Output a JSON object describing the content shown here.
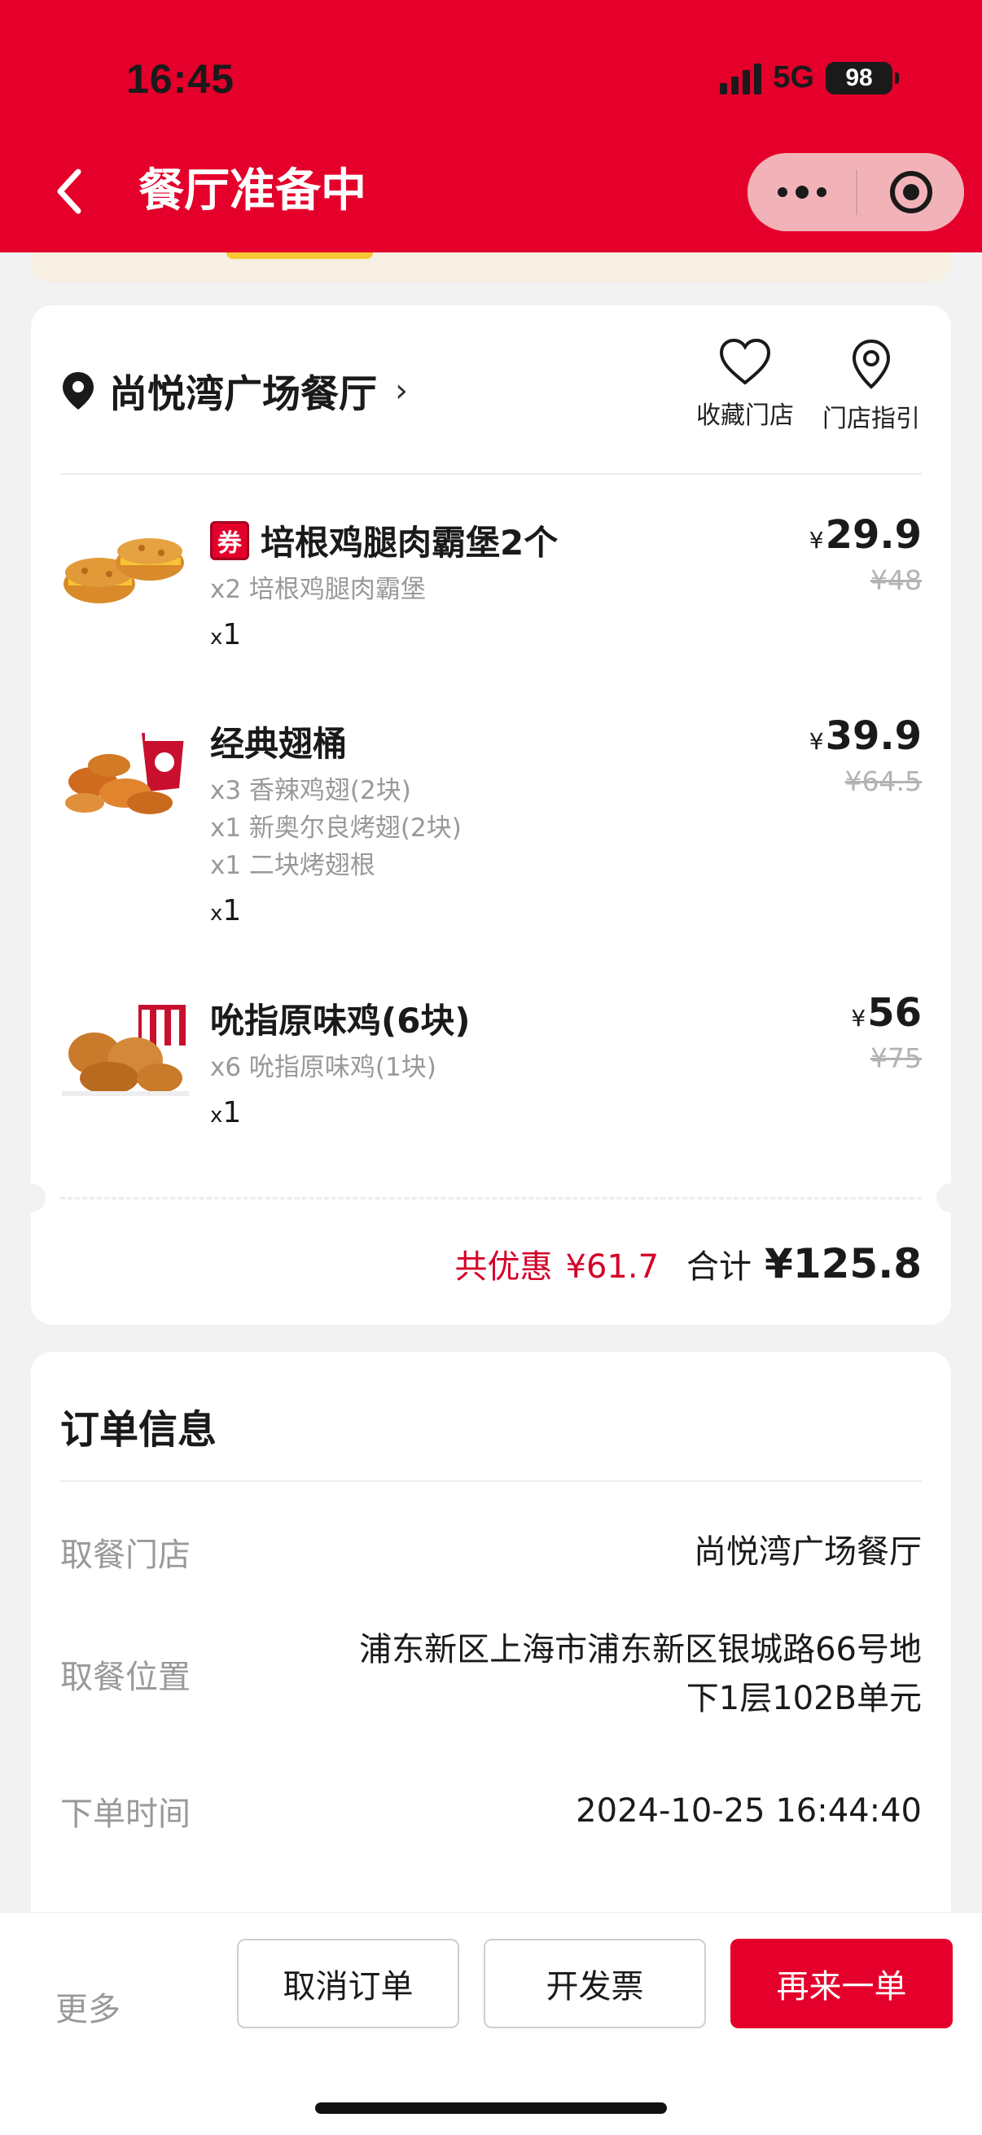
{
  "status_bar": {
    "time": "16:45",
    "network": "5G",
    "battery": "98"
  },
  "nav": {
    "title": "餐厅准备中"
  },
  "store": {
    "name": "尚悦湾广场餐厅",
    "arrow": "›",
    "favorite_label": "收藏门店",
    "guide_label": "门店指引"
  },
  "items": [
    {
      "coupon_badge": "券",
      "name": "培根鸡腿肉霸堡2个",
      "subs": [
        "x2 培根鸡腿肉霸堡"
      ],
      "qty_prefix": "x",
      "qty": "1",
      "currency": "¥",
      "price": "29.9",
      "original_price": "¥48"
    },
    {
      "name": "经典翅桶",
      "subs": [
        "x3 香辣鸡翅(2块)",
        "x1 新奥尔良烤翅(2块)",
        "x1 二块烤翅根"
      ],
      "qty_prefix": "x",
      "qty": "1",
      "currency": "¥",
      "price": "39.9",
      "original_price": "¥64.5"
    },
    {
      "name": "吮指原味鸡(6块)",
      "subs": [
        "x6 吮指原味鸡(1块)"
      ],
      "qty_prefix": "x",
      "qty": "1",
      "currency": "¥",
      "price": "56",
      "original_price": "¥75"
    }
  ],
  "totals": {
    "discount_label": "共优惠",
    "discount_value": "¥61.7",
    "total_label": "合计",
    "total_value": "¥125.8"
  },
  "order_info": {
    "title": "订单信息",
    "rows": [
      {
        "label": "取餐门店",
        "value": "尚悦湾广场餐厅"
      },
      {
        "label": "取餐位置",
        "value_line1": "浦东新区上海市浦东新区银城路66号地",
        "value_line2": "下1层102B单元"
      },
      {
        "label": "下单时间",
        "value": "2024-10-25 16:44:40"
      }
    ]
  },
  "bottom_bar": {
    "more": "更多",
    "cancel": "取消订单",
    "invoice": "开发票",
    "reorder": "再来一单"
  },
  "colors": {
    "brand_red": "#e4002b",
    "discount_red": "#d4002a"
  }
}
